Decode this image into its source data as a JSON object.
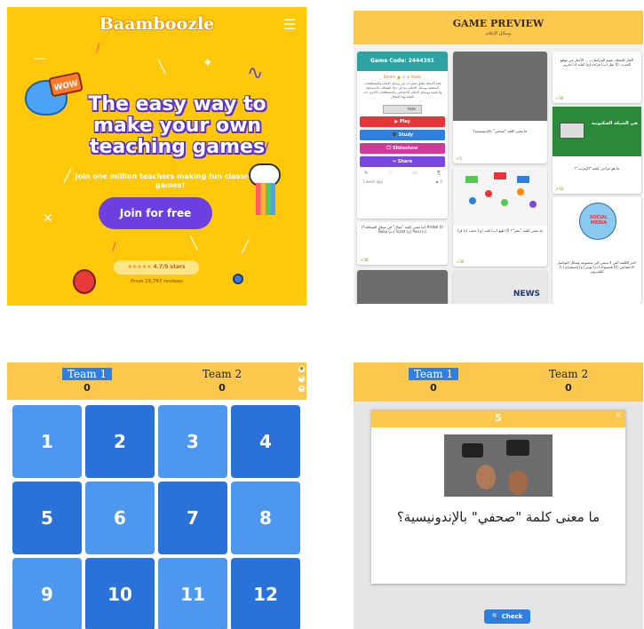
{
  "landing": {
    "logo": "Baamboozle",
    "menu_icon": "☰",
    "badge": "WOW",
    "headline": "The easy way to make your own teaching games",
    "subtext": "Join one million teachers making fun classroom games!",
    "join_label": "Join for free",
    "stars": "★★★★★",
    "rating_text": "4.7/5 stars",
    "reviews_text": "From 19,797 reviews",
    "colors": {
      "background": "#ffc80a",
      "button": "#6b3fe0"
    }
  },
  "preview": {
    "title": "GAME PREVIEW",
    "subtitle": "وسائل الإعلام",
    "game_code": "Game Code: 2444391",
    "meta": "Dmntn 🔒 cr ⊕ Public",
    "description": "هذه الأسئلة تتعلق بمفردات عن وسائل الإعلام والمصطلحات المتعلقة بوسائل الإعلام، بما في ذلك الشبكات الاجتماعية والرقمية ووسائل الإعلام الاجتماعي والمصطلحات الأخرى ذات الصلة بهذا المجال",
    "toggle_label": "Hide",
    "buttons": [
      {
        "label": "▶ Play",
        "color": "#e8353a"
      },
      {
        "label": "🎓 Study",
        "color": "#2f7fe0"
      },
      {
        "label": "🖵 Slideshow",
        "color": "#d0389a"
      },
      {
        "label": "↪ Share",
        "color": "#7a48e0"
      }
    ],
    "tools": [
      "✎",
      "♡",
      "▭",
      "⎘"
    ],
    "ago": "1 week ago",
    "plays": "▶ 9",
    "cards": [
      {
        "text": "ما معنى كلمة \"صحفي\" بالإندونيسية؟",
        "points": "✔5"
      },
      {
        "text": "(ما معنى كلمة \"مقال\" في سياق الصحافة؟) Artikel (أ) Buku (ب) Surat (ج) Puisi (د)",
        "points": "✔30"
      },
      {
        "text": "ما معنى كلمة \"نشر\"؟ (أ) طبع (ب) كتب (ج) حجب (د) قرأ",
        "points": "✔30"
      },
      {
        "text": "أكمل الجملة: يقوم المراسل بـ ... الأخبار من موقع الحدث. (أ) نقل (ب) قراءة (ج) كتابة (د) تحرير",
        "points": "✔30"
      },
      {
        "text": "ما هو مرادف كلمة \"الإنترنت\"؟",
        "points": "✔10"
      },
      {
        "text": "اختر الكلمة التي لا تنتمي إلى مجموعة وسائل التواصل الاجتماعي: (أ) فيسبوك (ب) تويتر (ج) إنستغرام (د) التلفزيون",
        "points": ""
      }
    ],
    "image_labels": {
      "news": "NEWS",
      "network_banner": "هي الشبكة العنكبوتية",
      "social": "SOCIAL MEDIA"
    }
  },
  "board": {
    "team1": "Team 1",
    "team2": "Team 2",
    "score1": "0",
    "score2": "0",
    "tiles": [
      "1",
      "2",
      "3",
      "4",
      "5",
      "6",
      "7",
      "8",
      "9",
      "10",
      "11",
      "12"
    ]
  },
  "question": {
    "team1": "Team 1",
    "team2": "Team 2",
    "score1": "0",
    "score2": "0",
    "number": "5",
    "close": "×",
    "text": "ما معنى كلمة \"صحفي\" بالإندونيسية؟",
    "check_label": "🔍 Check"
  }
}
